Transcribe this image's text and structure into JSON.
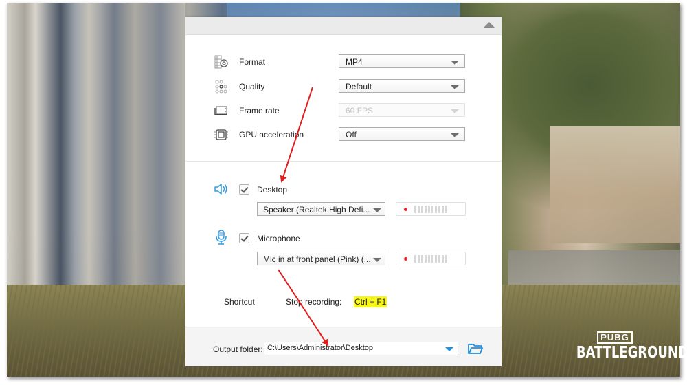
{
  "background": {
    "game_logo_top": "PUBG",
    "game_logo_bottom": "BATTLEGROUNDS"
  },
  "panel": {
    "collapse_icon": "triangle-up-icon",
    "video_settings": [
      {
        "label": "Format",
        "value": "MP4",
        "icon": "format-gear-icon",
        "enabled": true
      },
      {
        "label": "Quality",
        "value": "Default",
        "icon": "quality-dots-icon",
        "enabled": true
      },
      {
        "label": "Frame rate",
        "value": "60 FPS",
        "icon": "frame-rate-icon",
        "enabled": false
      },
      {
        "label": "GPU acceleration",
        "value": "Off",
        "icon": "chip-icon",
        "enabled": true
      }
    ],
    "audio": [
      {
        "label": "Desktop",
        "checked": true,
        "icon": "speaker-icon",
        "device": "Speaker (Realtek High Defi...",
        "level_bars": 10
      },
      {
        "label": "Microphone",
        "checked": true,
        "icon": "microphone-icon",
        "device": "Mic in at front panel (Pink) (...",
        "level_bars": 10
      }
    ],
    "shortcut": {
      "label": "Shortcut",
      "action": "Stop recording:",
      "keys": "Ctrl + F1"
    },
    "output": {
      "label": "Output folder:",
      "path": "C:\\Users\\Administrator\\Desktop",
      "folder_icon": "folder-open-icon"
    }
  },
  "colors": {
    "accent_blue": "#1f8fe0",
    "highlight_yellow": "#f7f71a",
    "annotation_red": "#e21b1b",
    "record_dot": "#e5262d"
  }
}
